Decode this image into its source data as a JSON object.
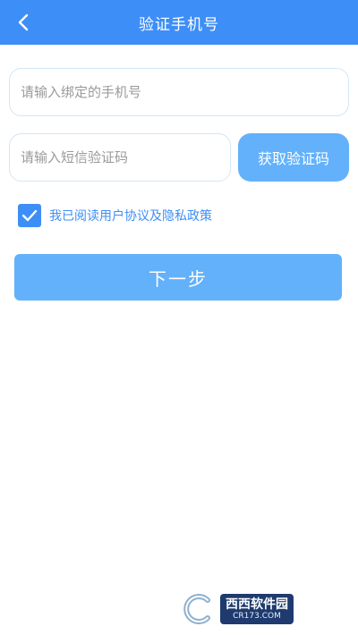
{
  "header": {
    "title": "验证手机号",
    "back_icon": "chevron-left-icon"
  },
  "form": {
    "phone_placeholder": "请输入绑定的手机号",
    "phone_value": "",
    "code_placeholder": "请输入短信验证码",
    "code_value": "",
    "get_code_label": "获取验证码",
    "agreement_checked": true,
    "agreement_text": "我已阅读用户协议及隐私政策",
    "next_label": "下一步"
  },
  "watermark": {
    "brand": "西西软件园",
    "site": "CR173.COM"
  },
  "colors": {
    "header": "#3e8ef7",
    "button": "#63b1fb",
    "input_border": "#d3e6f6",
    "placeholder": "#9a9a9a"
  }
}
